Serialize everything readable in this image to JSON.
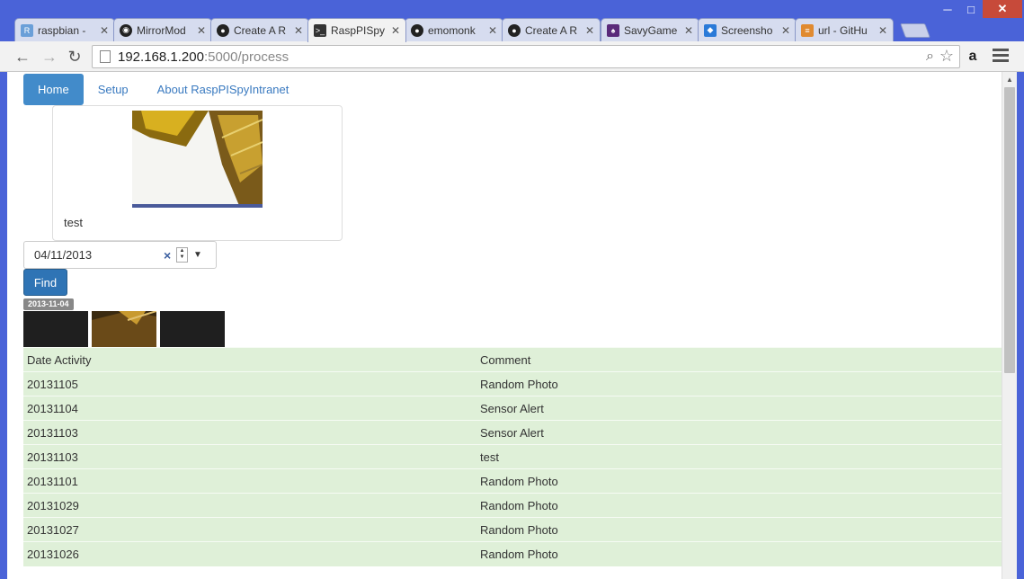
{
  "window": {
    "minimize": "─",
    "maximize": "□",
    "close": "✕"
  },
  "tabs": [
    {
      "label": "raspbian -",
      "icon": "raspbian-icon",
      "color": "#6a9fd8"
    },
    {
      "label": "MirrorMod",
      "icon": "mirror-icon",
      "color": "#222"
    },
    {
      "label": "Create A R",
      "icon": "github-icon",
      "color": "#222"
    },
    {
      "label": "RaspPISpy",
      "icon": "terminal-icon",
      "color": "#333",
      "active": true
    },
    {
      "label": "emomonk",
      "icon": "github-icon",
      "color": "#222"
    },
    {
      "label": "Create A R",
      "icon": "github-icon",
      "color": "#222"
    },
    {
      "label": "SavyGame",
      "icon": "savygame-icon",
      "color": "#5a2a7a"
    },
    {
      "label": "Screensho",
      "icon": "dropbox-icon",
      "color": "#2a7ad8"
    },
    {
      "label": "url - GitHu",
      "icon": "stackoverflow-icon",
      "color": "#e08a30"
    }
  ],
  "toolbar": {
    "back": "←",
    "forward": "→",
    "reload": "↻",
    "url_host": "192.168.1.200",
    "url_rest": ":5000/process",
    "amazon": "a"
  },
  "nav": {
    "home": "Home",
    "setup": "Setup",
    "about": "About RaspPISpyIntranet"
  },
  "card": {
    "caption": "test"
  },
  "date_filter": {
    "value": "04/11/2013",
    "clear": "×",
    "drop": "▼"
  },
  "find_label": "Find",
  "badge": "2013-11-04",
  "table": {
    "headers": [
      "Date Activity",
      "Comment"
    ],
    "rows": [
      [
        "20131105",
        "Random Photo"
      ],
      [
        "20131104",
        "Sensor Alert"
      ],
      [
        "20131103",
        "Sensor Alert"
      ],
      [
        "20131103",
        "test"
      ],
      [
        "20131101",
        "Random Photo"
      ],
      [
        "20131029",
        "Random Photo"
      ],
      [
        "20131027",
        "Random Photo"
      ],
      [
        "20131026",
        "Random Photo"
      ]
    ]
  }
}
